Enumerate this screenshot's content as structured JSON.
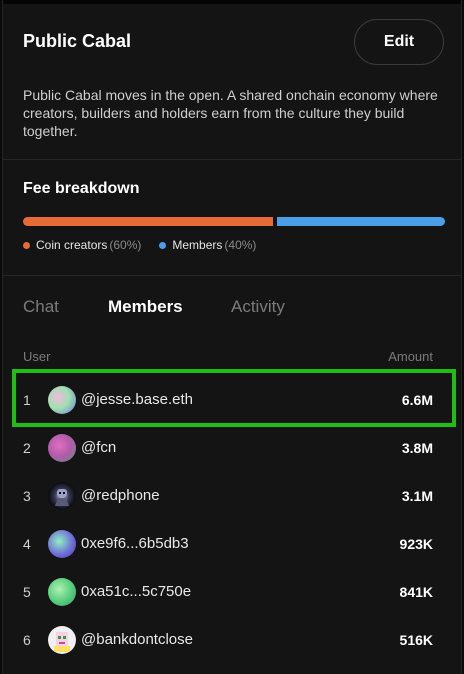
{
  "header": {
    "title": "Public Cabal",
    "edit_label": "Edit",
    "description": "Public Cabal moves in the open. A shared onchain economy where creators, builders and holders earn from the culture they build together."
  },
  "fee_breakdown": {
    "title": "Fee breakdown",
    "segments": [
      {
        "label": "Coin creators",
        "percent_label": "(60%)",
        "share": 0.6,
        "color": "#e66b37"
      },
      {
        "label": "Members",
        "percent_label": "(40%)",
        "share": 0.4,
        "color": "#4a9fe8"
      }
    ]
  },
  "tabs": [
    {
      "label": "Chat",
      "active": false
    },
    {
      "label": "Members",
      "active": true
    },
    {
      "label": "Activity",
      "active": false
    }
  ],
  "table": {
    "headers": {
      "user": "User",
      "amount": "Amount"
    },
    "rows": [
      {
        "rank": "1",
        "user": "@jesse.base.eth",
        "amount": "6.6M",
        "avatar": "gradient-avatar"
      },
      {
        "rank": "2",
        "user": "@fcn",
        "amount": "3.8M",
        "avatar": "gradient-avatar"
      },
      {
        "rank": "3",
        "user": "@redphone",
        "amount": "3.1M",
        "avatar": "robot-avatar"
      },
      {
        "rank": "4",
        "user": "0xe9f6...6b5db3",
        "amount": "923K",
        "avatar": "gradient-avatar"
      },
      {
        "rank": "5",
        "user": "0xa51c...5c750e",
        "amount": "841K",
        "avatar": "gradient-avatar"
      },
      {
        "rank": "6",
        "user": "@bankdontclose",
        "amount": "516K",
        "avatar": "pixel-avatar"
      }
    ]
  },
  "highlight_color": "#1fbe14"
}
